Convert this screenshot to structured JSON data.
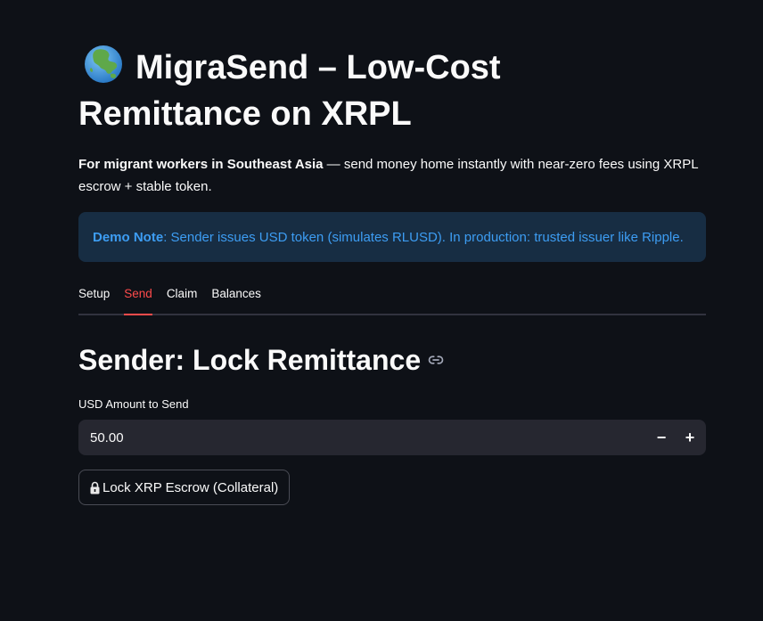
{
  "header": {
    "title": "MigraSend – Low-Cost Remittance on XRPL",
    "title_icon": "globe-asia-icon"
  },
  "intro": {
    "bold": "For migrant workers in Southeast Asia",
    "rest": " — send money home instantly with near-zero fees using XRPL escrow + stable token."
  },
  "info": {
    "label": "Demo Note",
    "text": ": Sender issues USD token (simulates RLUSD). In production: trusted issuer like Ripple.",
    "color": "#3d9df3",
    "background": "#172d43"
  },
  "tabs": [
    {
      "label": "Setup",
      "active": false
    },
    {
      "label": "Send",
      "active": true
    },
    {
      "label": "Claim",
      "active": false
    },
    {
      "label": "Balances",
      "active": false
    }
  ],
  "send": {
    "heading": "Sender: Lock Remittance",
    "amount_label": "USD Amount to Send",
    "amount_value": "50.00",
    "minus_label": "−",
    "plus_label": "+",
    "lock_button_label": "Lock XRP Escrow (Collateral)"
  },
  "colors": {
    "background": "#0e1117",
    "accent": "#ff4b4b",
    "input_bg": "#262730"
  }
}
